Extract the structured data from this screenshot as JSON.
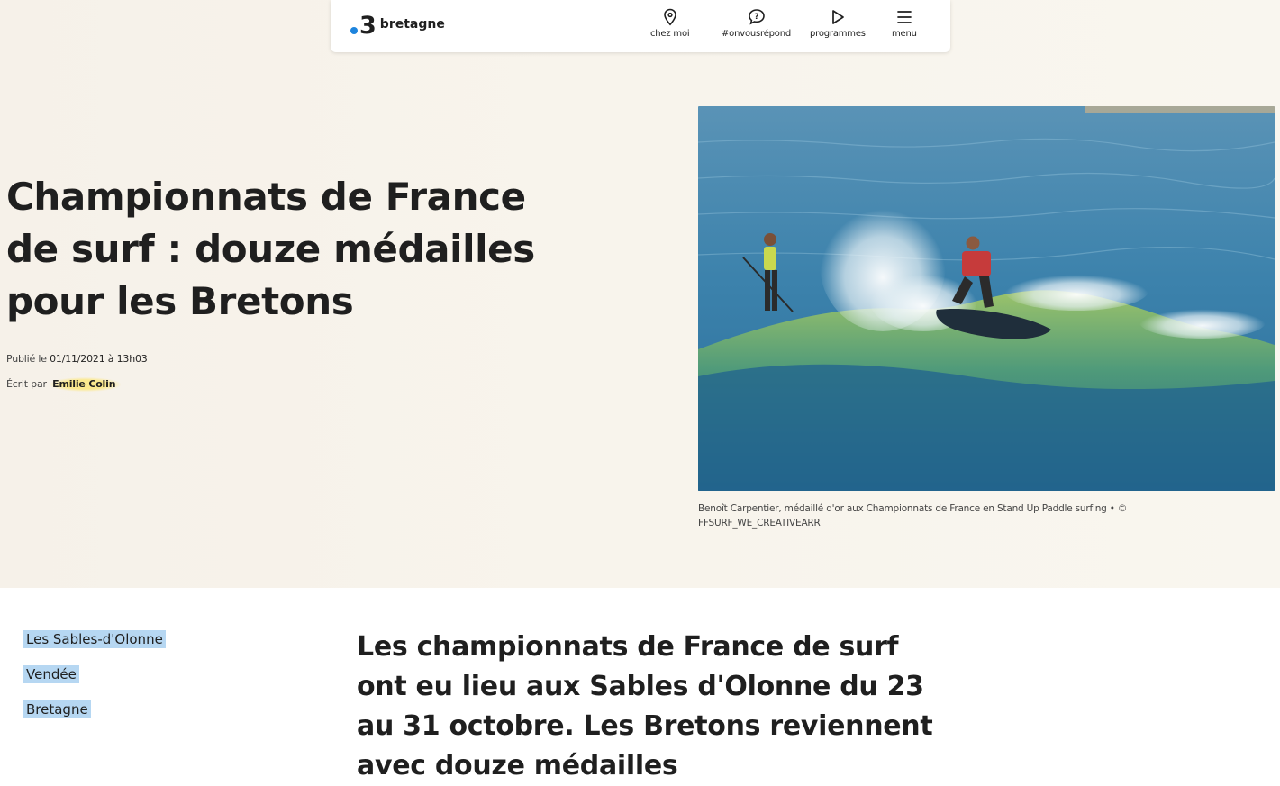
{
  "colors": {
    "accent_blue": "#1d84dd",
    "author_highlight": "#fbe98e",
    "tag_highlight": "#b6d7f2",
    "hero_bg": "#f8f4ec"
  },
  "header": {
    "logo_number": "3",
    "logo_name": "bretagne",
    "nav": [
      {
        "label": "chez moi",
        "icon": "location-pin-icon"
      },
      {
        "label": "#onvousrépond",
        "icon": "chat-question-icon"
      },
      {
        "label": "programmes",
        "icon": "play-icon"
      },
      {
        "label": "menu",
        "icon": "hamburger-menu-icon"
      }
    ]
  },
  "article": {
    "title": "Championnats de France de surf : douze médailles pour les Bretons",
    "published_prefix": "Publié le ",
    "published_date": "01/11/2021 à 13h03",
    "written_prefix": "Écrit par ",
    "author": "Emilie Colin",
    "image_caption": "Benoît Carpentier, médaillé d'or aux Championnats de France en Stand Up Paddle surfing • © FFSURF_WE_CREATIVEARR",
    "tags": [
      "Les Sables-d'Olonne",
      "Vendée",
      "Bretagne"
    ],
    "lead": "Les championnats de France de surf ont eu lieu aux Sables d'Olonne du 23 au 31 octobre. Les Bretons reviennent avec douze médailles"
  }
}
